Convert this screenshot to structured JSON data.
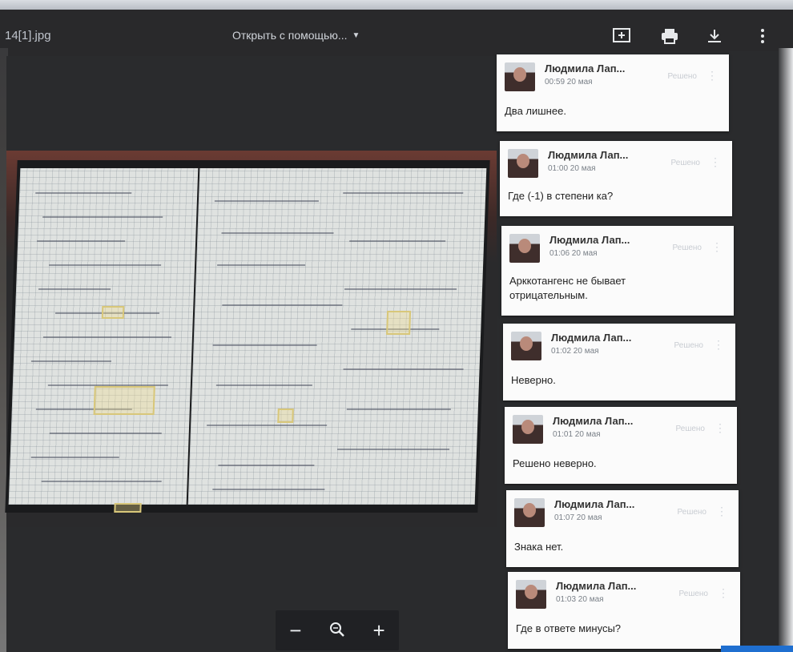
{
  "header": {
    "filename": "14[1].jpg",
    "open_with": "Открыть с помощью...",
    "icons": [
      "add-comment-icon",
      "print-icon",
      "download-icon",
      "more-vert-icon"
    ]
  },
  "zoom": {
    "minus": "−",
    "plus": "+",
    "icon": "zoom-icon"
  },
  "comments": [
    {
      "author": "Людмила Лап...",
      "time": "00:59 20 мая",
      "resolve": "Решено",
      "text": "Два лишнее."
    },
    {
      "author": "Людмила Лап...",
      "time": "01:00 20 мая",
      "resolve": "Решено",
      "text": "Где (-1) в степени ка?"
    },
    {
      "author": "Людмила Лап...",
      "time": "01:06 20 мая",
      "resolve": "Решено",
      "text": "Арккотангенс не бывает отрицательным."
    },
    {
      "author": "Людмила Лап...",
      "time": "01:02 20 мая",
      "resolve": "Решено",
      "text": "Неверно."
    },
    {
      "author": "Людмила Лап...",
      "time": "01:01 20 мая",
      "resolve": "Решено",
      "text": "Решено неверно."
    },
    {
      "author": "Людмила Лап...",
      "time": "01:07 20 мая",
      "resolve": "Решено",
      "text": "Знака нет."
    },
    {
      "author": "Людмила Лап...",
      "time": "01:03 20 мая",
      "resolve": "Решено",
      "text": "Где в ответе минусы?"
    }
  ]
}
